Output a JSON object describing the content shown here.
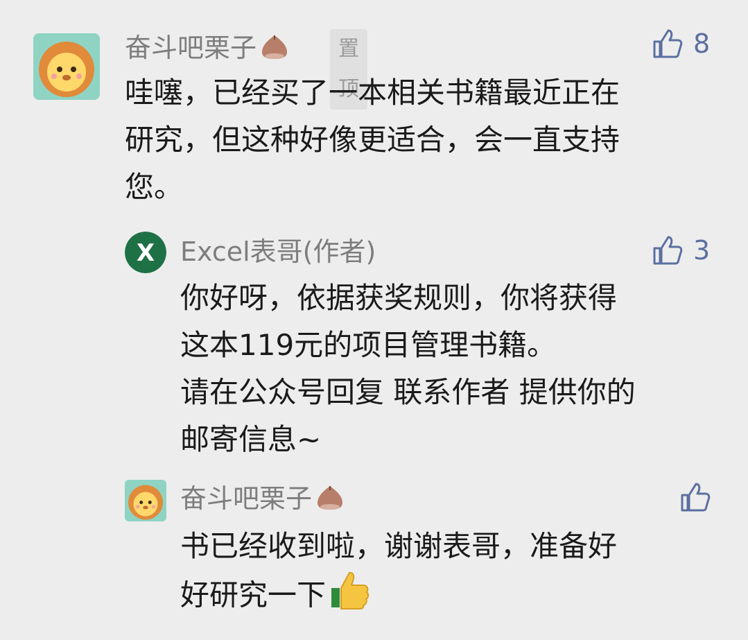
{
  "comments": [
    {
      "name": "奋斗吧栗子",
      "pinned_label": "置顶",
      "likes": "8",
      "lines": [
        "哇噻，已经买了一本相关书籍最近正在",
        "研究，但这种好像更适合，会一直支持",
        "您。"
      ]
    },
    {
      "name": "Excel表哥(作者)",
      "avatar_letter": "X",
      "likes": "3",
      "lines": [
        "你好呀，依据获奖规则，你将获得",
        "这本119元的项目管理书籍。",
        "请在公众号回复 联系作者 提供你的",
        "邮寄信息~"
      ]
    },
    {
      "name": "奋斗吧栗子",
      "likes": "",
      "lines": [
        "书已经收到啦，谢谢表哥，准备好",
        "好研究一下"
      ]
    }
  ],
  "colors": {
    "background": "#ededed",
    "name": "#7d7d7d",
    "like": "#5b6fa0",
    "excel_green": "#1e7145"
  }
}
